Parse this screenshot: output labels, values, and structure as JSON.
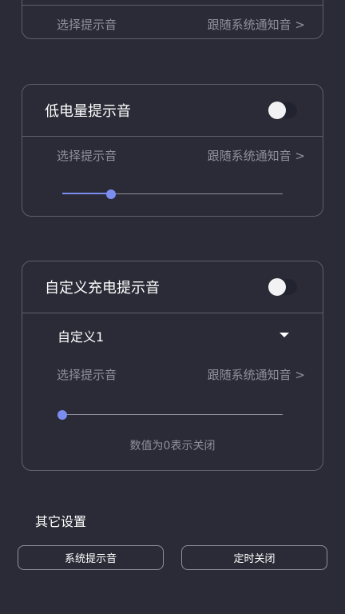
{
  "card_top": {
    "select_label": "选择提示音",
    "select_value": "跟随系统通知音 >"
  },
  "low_battery": {
    "title": "低电量提示音",
    "enabled": false,
    "select_label": "选择提示音",
    "select_value": "跟随系统通知音 >",
    "volume_fraction": 0.22
  },
  "custom_charge": {
    "title": "自定义充电提示音",
    "enabled": false,
    "preset": "自定义1",
    "select_label": "选择提示音",
    "select_value": "跟随系统通知音 >",
    "volume_fraction": 0.0,
    "hint": "数值为0表示关闭"
  },
  "other": {
    "title": "其它设置",
    "buttons": [
      "系统提示音",
      "定时关闭"
    ]
  },
  "colors": {
    "background": "#2a2b36",
    "accent": "#7b8ef0",
    "border": "#5d5f6b",
    "muted_text": "#8e909b"
  }
}
